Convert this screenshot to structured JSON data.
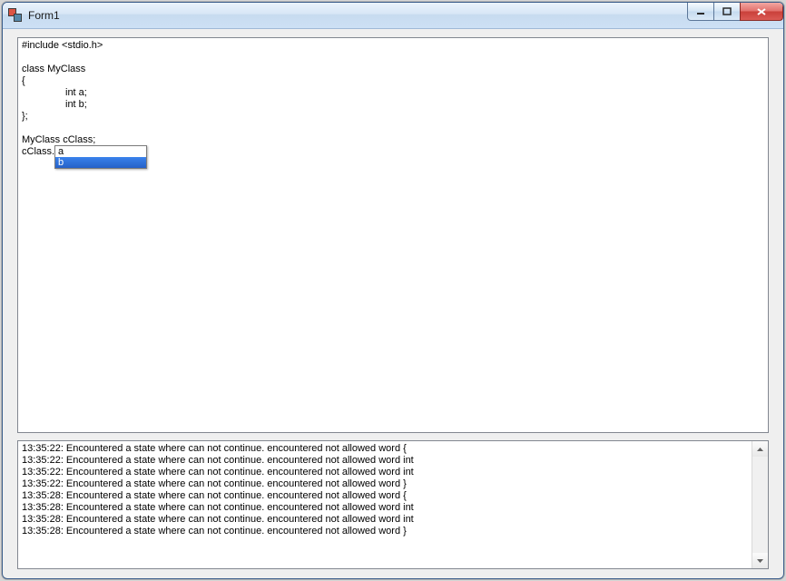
{
  "window": {
    "title": "Form1"
  },
  "editor": {
    "lines": [
      "#include <stdio.h>",
      "",
      "class MyClass",
      "{",
      "INDENTint a;",
      "INDENTint b;",
      "};",
      "",
      "MyClass cClass;",
      "cClass."
    ],
    "autocomplete": {
      "items": [
        "a",
        "b"
      ],
      "selected_index": 1
    }
  },
  "log": {
    "lines": [
      "13:35:22: Encountered a state where can not continue. encountered not allowed word {",
      "13:35:22: Encountered a state where can not continue. encountered not allowed word int",
      "13:35:22: Encountered a state where can not continue. encountered not allowed word int",
      "13:35:22: Encountered a state where can not continue. encountered not allowed word }",
      "13:35:28: Encountered a state where can not continue. encountered not allowed word {",
      "13:35:28: Encountered a state where can not continue. encountered not allowed word int",
      "13:35:28: Encountered a state where can not continue. encountered not allowed word int",
      "13:35:28: Encountered a state where can not continue. encountered not allowed word }"
    ]
  }
}
